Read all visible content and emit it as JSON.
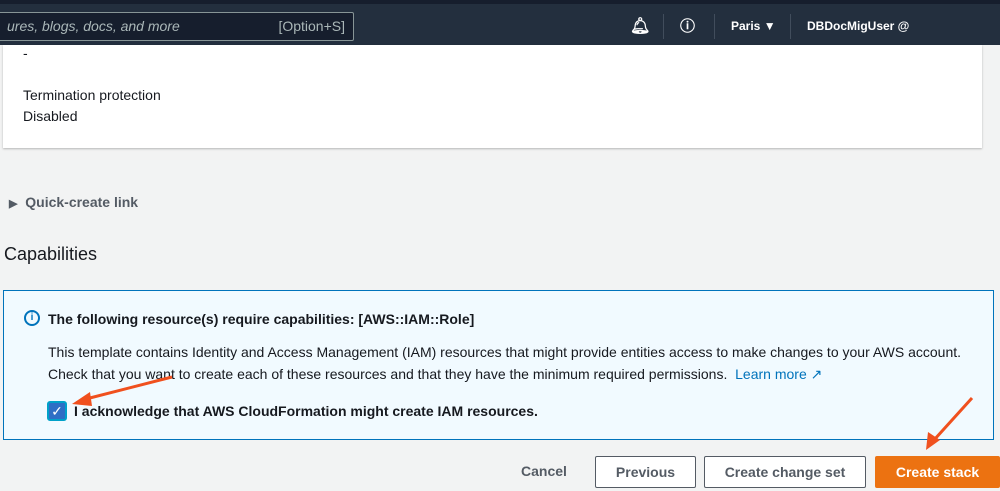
{
  "topbar": {
    "search_placeholder": "ures, blogs, docs, and more",
    "search_shortcut": "[Option+S]",
    "region": "Paris",
    "user": "DBDocMigUser @"
  },
  "card": {
    "dash": "-",
    "termination_label": "Termination protection",
    "termination_value": "Disabled"
  },
  "quick_create": "Quick-create link",
  "capabilities": {
    "heading": "Capabilities",
    "info_title": "The following resource(s) require capabilities: [AWS::IAM::Role]",
    "info_text": "This template contains Identity and Access Management (IAM) resources that might provide entities access to make changes to your AWS account. Check that you want to create each of these resources and that they have the minimum required permissions.",
    "learn_more": "Learn more",
    "acknowledge": "I acknowledge that AWS CloudFormation might create IAM resources.",
    "acknowledge_checked": true
  },
  "actions": {
    "cancel": "Cancel",
    "previous": "Previous",
    "change_set": "Create change set",
    "create": "Create stack"
  },
  "colors": {
    "accent": "#ec7211",
    "arrow": "#f0501e",
    "link": "#0073bb"
  }
}
